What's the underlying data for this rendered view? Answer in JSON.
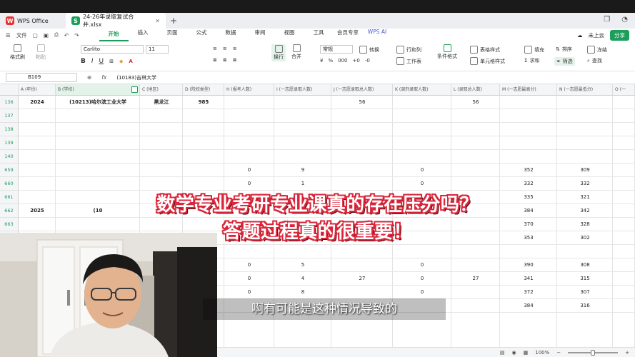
{
  "tabs": {
    "wps_label": "WPS Office",
    "file_label": "24-26年录取复试合并.xlsx",
    "file_badge": "S",
    "wps_badge": "W"
  },
  "menu": {
    "file": "文件",
    "items": [
      "开始",
      "插入",
      "页面",
      "公式",
      "数据",
      "审阅",
      "视图",
      "工具",
      "会员专享",
      "WPS AI"
    ],
    "cloud": "未上云",
    "share": "分享"
  },
  "ribbon": {
    "format_painter": "格式刷",
    "paste": "粘贴",
    "font_name": "Carlito",
    "font_size": "11",
    "number_format": "常规",
    "convert": "转换",
    "rows_cols": "行和列",
    "worksheet": "工作表",
    "wrap": "换行",
    "merge": "合并",
    "table_style": "表格样式",
    "conditional": "条件格式",
    "cell_style": "单元格样式",
    "fill": "填充",
    "sort": "排序",
    "freeze": "冻结",
    "sum": "求和",
    "filter": "筛选",
    "find": "查找"
  },
  "formula_bar": {
    "cell_ref": "B109",
    "fx": "fx",
    "content": "(10183)吉林大学"
  },
  "columns": [
    "A (年份)",
    "B (学校)",
    "C (地区)",
    "D (院校类型)",
    "H (报考人数)",
    "I (一志愿录取人数)",
    "J (一志愿录取总人数)",
    "K (调剂录取人数)",
    "L (录取总人数)",
    "M (一志愿最高分)",
    "N (一志愿最低分)",
    "O (一"
  ],
  "row_numbers": [
    "136",
    "137",
    "138",
    "139",
    "140",
    "659",
    "660",
    "661",
    "662",
    "663",
    "",
    "",
    "",
    "",
    "",
    ""
  ],
  "rows": [
    {
      "A": "2024",
      "B": "(10213)哈尔滨工业大学",
      "C": "黑龙江",
      "D": "985",
      "H": "",
      "I": "",
      "J": "56",
      "K": "",
      "L": "56",
      "M": "",
      "N": ""
    },
    {
      "A": "",
      "B": "",
      "C": "",
      "D": "",
      "H": "",
      "I": "",
      "J": "",
      "K": "",
      "L": "",
      "M": "",
      "N": ""
    },
    {
      "A": "",
      "B": "",
      "C": "",
      "D": "",
      "H": "",
      "I": "",
      "J": "",
      "K": "",
      "L": "",
      "M": "",
      "N": ""
    },
    {
      "A": "",
      "B": "",
      "C": "",
      "D": "",
      "H": "",
      "I": "",
      "J": "",
      "K": "",
      "L": "",
      "M": "",
      "N": ""
    },
    {
      "A": "",
      "B": "",
      "C": "",
      "D": "",
      "H": "",
      "I": "",
      "J": "",
      "K": "",
      "L": "",
      "M": "",
      "N": ""
    },
    {
      "A": "",
      "B": "",
      "C": "",
      "D": "",
      "H": "0",
      "I": "9",
      "J": "",
      "K": "0",
      "L": "",
      "M": "352",
      "N": "309"
    },
    {
      "A": "",
      "B": "",
      "C": "",
      "D": "",
      "H": "0",
      "I": "1",
      "J": "",
      "K": "0",
      "L": "",
      "M": "332",
      "N": "332"
    },
    {
      "A": "",
      "B": "",
      "C": "",
      "D": "",
      "H": "",
      "I": "",
      "J": "",
      "K": "",
      "L": "",
      "M": "335",
      "N": "321"
    },
    {
      "A": "2025",
      "B": "(10",
      "C": "",
      "D": "",
      "H": "",
      "I": "",
      "J": "",
      "K": "",
      "L": "",
      "M": "384",
      "N": "342"
    },
    {
      "A": "",
      "B": "",
      "C": "",
      "D": "",
      "H": "",
      "I": "",
      "J": "",
      "K": "",
      "L": "",
      "M": "370",
      "N": "328"
    },
    {
      "A": "",
      "B": "",
      "C": "",
      "D": "",
      "H": "",
      "I": "",
      "J": "",
      "K": "",
      "L": "",
      "M": "353",
      "N": "302"
    },
    {
      "A": "",
      "B": "",
      "C": "",
      "D": "",
      "H": "",
      "I": "",
      "J": "",
      "K": "",
      "L": "",
      "M": "",
      "N": ""
    },
    {
      "A": "",
      "B": "",
      "C": "",
      "D": "",
      "H": "0",
      "I": "5",
      "J": "",
      "K": "0",
      "L": "",
      "M": "390",
      "N": "308"
    },
    {
      "A": "",
      "B": "",
      "C": "",
      "D": "",
      "H": "0",
      "I": "4",
      "J": "27",
      "K": "0",
      "L": "27",
      "M": "341",
      "N": "315"
    },
    {
      "A": "",
      "B": "",
      "C": "",
      "D": "",
      "H": "0",
      "I": "8",
      "J": "",
      "K": "0",
      "L": "",
      "M": "372",
      "N": "307"
    },
    {
      "A": "",
      "B": "",
      "C": "",
      "D": "",
      "H": "",
      "I": "",
      "J": "",
      "K": "",
      "L": "",
      "M": "384",
      "N": "316"
    }
  ],
  "overlay": {
    "title_line1": "数学专业考研专业课真的存在压分吗？",
    "title_line2": "答题过程真的很重要！",
    "subtitle": "啊有可能是这种情况导致的"
  },
  "statusbar": {
    "zoom": "100%"
  }
}
